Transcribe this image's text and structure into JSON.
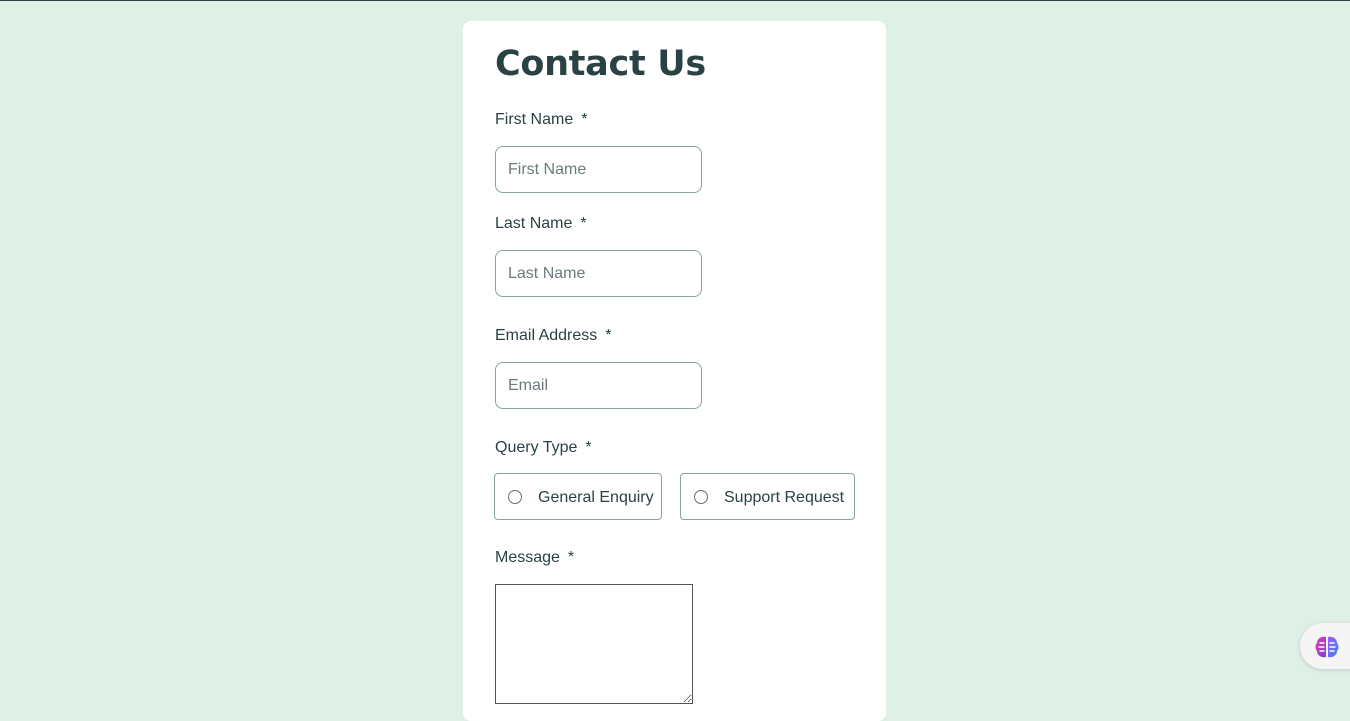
{
  "form": {
    "title": "Contact Us",
    "required_marker": "*",
    "first_name": {
      "label": "First Name",
      "placeholder": "First Name",
      "value": ""
    },
    "last_name": {
      "label": "Last Name",
      "placeholder": "Last Name",
      "value": ""
    },
    "email": {
      "label": "Email Address",
      "placeholder": "Email",
      "value": ""
    },
    "query_type": {
      "label": "Query Type",
      "options": [
        "General Enquiry",
        "Support Request"
      ],
      "selected": null
    },
    "message": {
      "label": "Message",
      "value": ""
    }
  },
  "widgets": {
    "assistant_icon": "brain-icon"
  },
  "colors": {
    "page_background": "#dff0e6",
    "card_background": "#ffffff",
    "text": "#2a4244",
    "input_border": "#87a3a6"
  }
}
